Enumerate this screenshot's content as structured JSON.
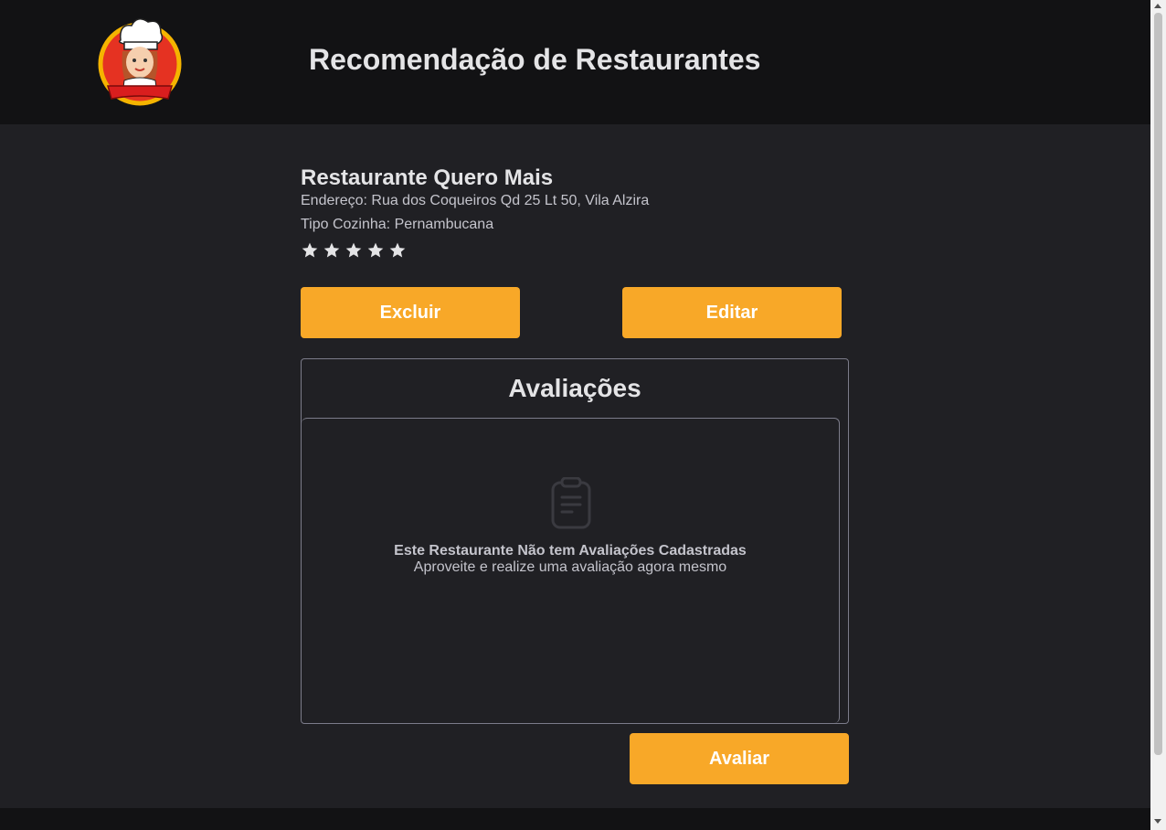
{
  "header": {
    "title": "Recomendação de Restaurantes",
    "logo_icon": "chef-logo-icon"
  },
  "restaurant": {
    "name": "Restaurante Quero Mais",
    "address": "Endereço: Rua dos Coqueiros Qd 25 Lt 50, Vila Alzira",
    "cuisine": "Tipo Cozinha: Pernambucana",
    "rating_filled": 0,
    "rating_max": 5
  },
  "actions": {
    "delete_label": "Excluir",
    "edit_label": "Editar",
    "rate_label": "Avaliar"
  },
  "reviews": {
    "title": "Avaliações",
    "empty_icon": "clipboard-icon",
    "empty_title": "Este Restaurante Não tem Avaliações Cadastradas",
    "empty_subtitle": "Aproveite e realize uma avaliação agora mesmo"
  },
  "colors": {
    "accent": "#f8a828",
    "background": "#202024",
    "header": "#121214"
  }
}
